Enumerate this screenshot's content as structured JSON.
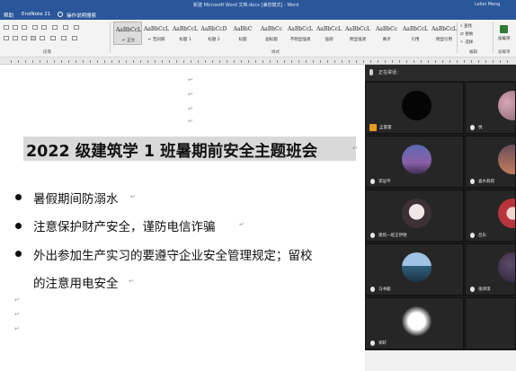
{
  "window": {
    "title": "新建 Microsoft Word 文档.docx [兼容模式] - Word",
    "user": "Leilei Meng"
  },
  "menu": {
    "tabs": [
      "帮助",
      "EndNote 21"
    ],
    "tellme": "操作说明搜索"
  },
  "ribbon": {
    "styles": [
      {
        "sample": "AaBbCcL",
        "name": "↵ 正文",
        "selected": true
      },
      {
        "sample": "AaBbCcL",
        "name": "↵ 无间隔",
        "selected": false
      },
      {
        "sample": "AaBbCcL",
        "name": "标题 1",
        "selected": false
      },
      {
        "sample": "AaBbCcD",
        "name": "标题 2",
        "selected": false
      },
      {
        "sample": "AaBbC",
        "name": "标题",
        "selected": false
      },
      {
        "sample": "AaBbCc",
        "name": "副标题",
        "selected": false
      },
      {
        "sample": "AaBbCcL",
        "name": "不明显强调",
        "selected": false
      },
      {
        "sample": "AaBbCcL",
        "name": "强调",
        "selected": false
      },
      {
        "sample": "AaBbCcL",
        "name": "明显强调",
        "selected": false
      },
      {
        "sample": "AaBbCc",
        "name": "要点",
        "selected": false
      },
      {
        "sample": "AaBbCcL",
        "name": "引用",
        "selected": false
      },
      {
        "sample": "AaBbCcL",
        "name": "明显引用",
        "selected": false
      }
    ],
    "group_labels": {
      "paragraph": "段落",
      "styles": "样式",
      "editing": "编辑",
      "addin": "加载项"
    },
    "editing": {
      "find": "查找",
      "replace": "替换",
      "select": "选择"
    },
    "addin_button": "加载项"
  },
  "document": {
    "title": "2022 级建筑学 1 班暑期前安全主题班会",
    "bullets": [
      "暑假期间防溺水",
      "注意保护财产安全，谨防电信诈骗",
      "外出参加生产实习的要遵守企业安全管理规定；留校"
    ],
    "continuation": "的注意用电安全",
    "paragraph_mark": "↵"
  },
  "meeting": {
    "title": "正在讲话：",
    "participants": [
      {
        "name": "孟雷雷",
        "host": true,
        "avatar": "black-scribble"
      },
      {
        "name": "悦",
        "host": false,
        "avatar": "pink-partial"
      },
      {
        "name": "李运平",
        "host": false,
        "avatar": "purple-scene"
      },
      {
        "name": "喜水莉莉",
        "host": false,
        "avatar": "sunset-partial"
      },
      {
        "name": "建筑一班王伊德",
        "host": false,
        "avatar": "anime-pink"
      },
      {
        "name": "吕乐",
        "host": false,
        "avatar": "anime-red"
      },
      {
        "name": "马书懿",
        "host": false,
        "avatar": "landscape-blue"
      },
      {
        "name": "张诗琪",
        "host": false,
        "avatar": "dark-partial"
      },
      {
        "name": "郑轩",
        "host": false,
        "avatar": "bw-branches"
      },
      {
        "name": "",
        "host": false,
        "avatar": "none"
      }
    ]
  }
}
